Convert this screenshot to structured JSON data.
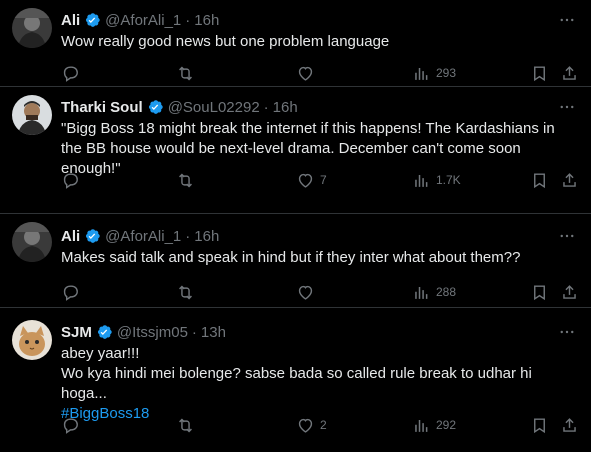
{
  "tweets": [
    {
      "name": "Ali",
      "handle": "@AforAli_1",
      "time": "16h",
      "text": "Wow really good news but one problem language",
      "hashtag": "",
      "replies": "",
      "retweets": "",
      "likes": "",
      "views": "293",
      "avatar": "bw-portrait"
    },
    {
      "name": "Tharki Soul",
      "handle": "@SouL02292",
      "time": "16h",
      "text": "\"Bigg Boss 18 might break the internet if this happens! The Kardashians in the BB house would be next-level drama. December can't come soon enough!\"",
      "hashtag": "",
      "replies": "",
      "retweets": "",
      "likes": "7",
      "views": "1.7K",
      "avatar": "portrait"
    },
    {
      "name": "Ali",
      "handle": "@AforAli_1",
      "time": "16h",
      "text": "Makes said talk and speak in hind but if they inter what about them??",
      "hashtag": "",
      "replies": "",
      "retweets": "",
      "likes": "",
      "views": "288",
      "avatar": "bw-portrait"
    },
    {
      "name": "SJM",
      "handle": "@Itssjm05",
      "time": "13h",
      "text": "abey yaar!!!\nWo kya hindi mei bolenge? sabse bada so called rule break to udhar hi hoga...",
      "hashtag": "#BiggBoss18",
      "replies": "",
      "retweets": "",
      "likes": "2",
      "views": "292",
      "avatar": "cat"
    }
  ],
  "colors": {
    "background": "#000000",
    "text": "#e7e9ea",
    "muted": "#71767b",
    "accent": "#1d9bf0",
    "border": "#2f3336"
  }
}
